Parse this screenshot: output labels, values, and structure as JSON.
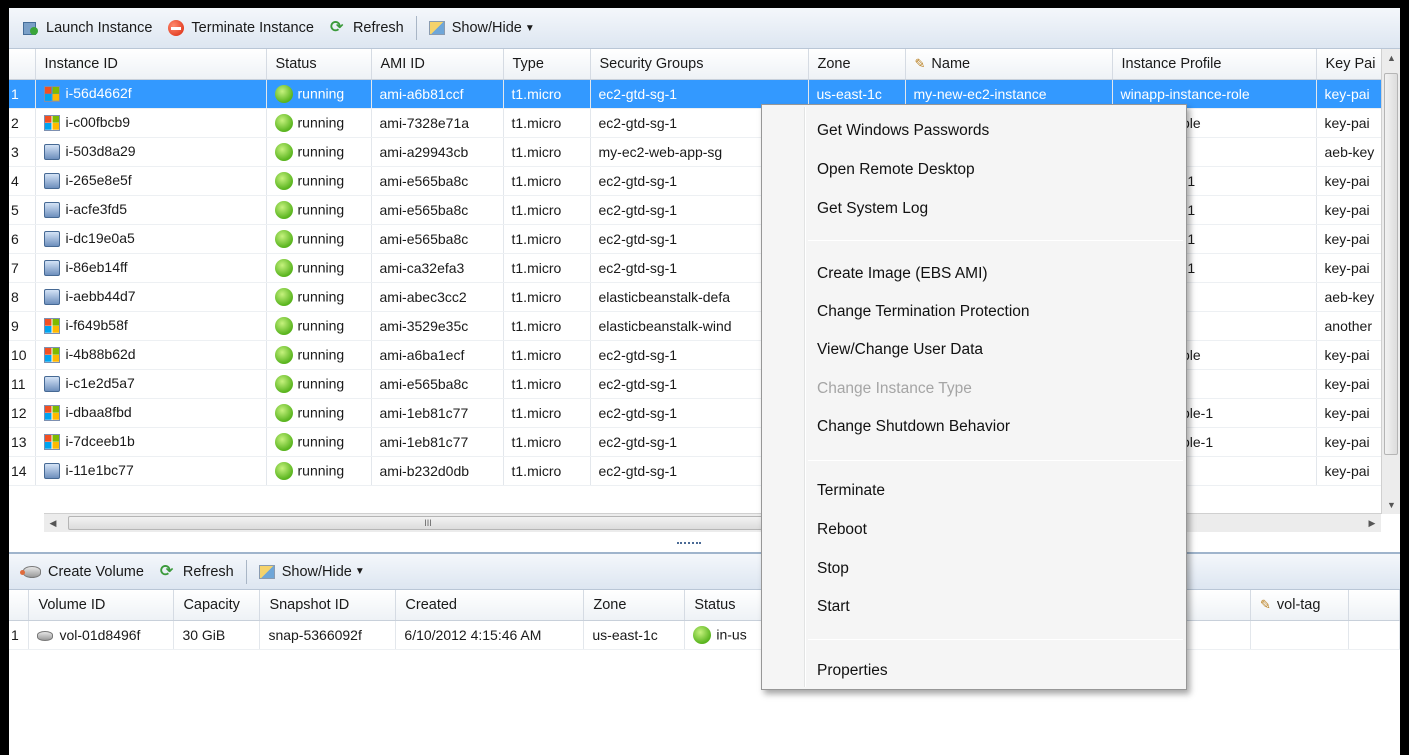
{
  "toolbar": {
    "launch_label": "Launch Instance",
    "terminate_label": "Terminate Instance",
    "refresh_label": "Refresh",
    "showhide_label": "Show/Hide"
  },
  "instances": {
    "columns": [
      "Instance ID",
      "Status",
      "AMI ID",
      "Type",
      "Security Groups",
      "Zone",
      "Name",
      "Instance Profile",
      "Key Pai"
    ],
    "rows": [
      {
        "n": "1",
        "icon": "windows",
        "id": "i-56d4662f",
        "status": "running",
        "ami": "ami-a6b81ccf",
        "type": "t1.micro",
        "sg": "ec2-gtd-sg-1",
        "zone": "us-east-1c",
        "name": "my-new-ec2-instance",
        "profile": "winapp-instance-role",
        "key": "key-pai"
      },
      {
        "n": "2",
        "icon": "windows",
        "id": "i-c00fbcb9",
        "status": "running",
        "ami": "ami-7328e71a",
        "type": "t1.micro",
        "sg": "ec2-gtd-sg-1",
        "zone": "",
        "name": "",
        "profile": "instance-role",
        "key": "key-pai"
      },
      {
        "n": "3",
        "icon": "linux",
        "id": "i-503d8a29",
        "status": "running",
        "ami": "ami-a29943cb",
        "type": "t1.micro",
        "sg": "my-ec2-web-app-sg",
        "zone": "",
        "name": "",
        "profile": "",
        "key": "aeb-key"
      },
      {
        "n": "4",
        "icon": "linux",
        "id": "i-265e8e5f",
        "status": "running",
        "ami": "ami-e565ba8c",
        "type": "t1.micro",
        "sg": "ec2-gtd-sg-1",
        "zone": "",
        "name": "",
        "profile": "tance-role-1",
        "key": "key-pai"
      },
      {
        "n": "5",
        "icon": "linux",
        "id": "i-acfe3fd5",
        "status": "running",
        "ami": "ami-e565ba8c",
        "type": "t1.micro",
        "sg": "ec2-gtd-sg-1",
        "zone": "",
        "name": "",
        "profile": "tance-role-1",
        "key": "key-pai"
      },
      {
        "n": "6",
        "icon": "linux",
        "id": "i-dc19e0a5",
        "status": "running",
        "ami": "ami-e565ba8c",
        "type": "t1.micro",
        "sg": "ec2-gtd-sg-1",
        "zone": "",
        "name": "",
        "profile": "tance-role-1",
        "key": "key-pai"
      },
      {
        "n": "7",
        "icon": "linux",
        "id": "i-86eb14ff",
        "status": "running",
        "ami": "ami-ca32efa3",
        "type": "t1.micro",
        "sg": "ec2-gtd-sg-1",
        "zone": "",
        "name": "",
        "profile": "tance-role-1",
        "key": "key-pai"
      },
      {
        "n": "8",
        "icon": "linux",
        "id": "i-aebb44d7",
        "status": "running",
        "ami": "ami-abec3cc2",
        "type": "t1.micro",
        "sg": "elasticbeanstalk-defa",
        "zone": "",
        "name": "",
        "profile": "",
        "key": "aeb-key"
      },
      {
        "n": "9",
        "icon": "windows",
        "id": "i-f649b58f",
        "status": "running",
        "ami": "ami-3529e35c",
        "type": "t1.micro",
        "sg": "elasticbeanstalk-wind",
        "zone": "",
        "name": "",
        "profile": "",
        "key": "another"
      },
      {
        "n": "10",
        "icon": "windows",
        "id": "i-4b88b62d",
        "status": "running",
        "ami": "ami-a6ba1ecf",
        "type": "t1.micro",
        "sg": "ec2-gtd-sg-1",
        "zone": "",
        "name": "",
        "profile": "instance-role",
        "key": "key-pai"
      },
      {
        "n": "11",
        "icon": "linux",
        "id": "i-c1e2d5a7",
        "status": "running",
        "ami": "ami-e565ba8c",
        "type": "t1.micro",
        "sg": "ec2-gtd-sg-1",
        "zone": "",
        "name": "",
        "profile": "",
        "key": "key-pai"
      },
      {
        "n": "12",
        "icon": "windows",
        "id": "i-dbaa8fbd",
        "status": "running",
        "ami": "ami-1eb81c77",
        "type": "t1.micro",
        "sg": "ec2-gtd-sg-1",
        "zone": "",
        "name": "",
        "profile": "instance-role-1",
        "key": "key-pai"
      },
      {
        "n": "13",
        "icon": "windows",
        "id": "i-7dceeb1b",
        "status": "running",
        "ami": "ami-1eb81c77",
        "type": "t1.micro",
        "sg": "ec2-gtd-sg-1",
        "zone": "",
        "name": "",
        "profile": "instance-role-1",
        "key": "key-pai"
      },
      {
        "n": "14",
        "icon": "linux",
        "id": "i-11e1bc77",
        "status": "running",
        "ami": "ami-b232d0db",
        "type": "t1.micro",
        "sg": "ec2-gtd-sg-1",
        "zone": "",
        "name": "",
        "profile": "",
        "key": "key-pai"
      }
    ]
  },
  "hscroll_grip": "III",
  "volume_toolbar": {
    "create_label": "Create Volume",
    "refresh_label": "Refresh",
    "showhide_label": "Show/Hide"
  },
  "volumes": {
    "columns": [
      "Volume ID",
      "Capacity",
      "Snapshot ID",
      "Created",
      "Zone",
      "Status",
      "vol-tag"
    ],
    "rows": [
      {
        "n": "1",
        "id": "vol-01d8496f",
        "capacity": "30 GiB",
        "snapshot": "snap-5366092f",
        "created": "6/10/2012 4:15:46 AM",
        "zone": "us-east-1c",
        "status": "in-us"
      }
    ]
  },
  "context_menu": {
    "items": [
      "Get Windows Passwords",
      "Open Remote Desktop",
      "Get System Log",
      "Create Image (EBS AMI)",
      "Change Termination Protection",
      "View/Change User Data",
      "Change Instance Type",
      "Change Shutdown Behavior",
      "Terminate",
      "Reboot",
      "Stop",
      "Start",
      "Properties"
    ]
  },
  "colors": {
    "selection": "#3399ff",
    "running": "#59b41e",
    "menu_bg": "#f5f5f5"
  },
  "icons": {
    "launch": "launch-instance-icon",
    "terminate": "terminate-icon",
    "refresh": "refresh-icon",
    "showhide": "show-hide-icon",
    "volume": "volume-icon",
    "pencil": "pencil-icon"
  }
}
